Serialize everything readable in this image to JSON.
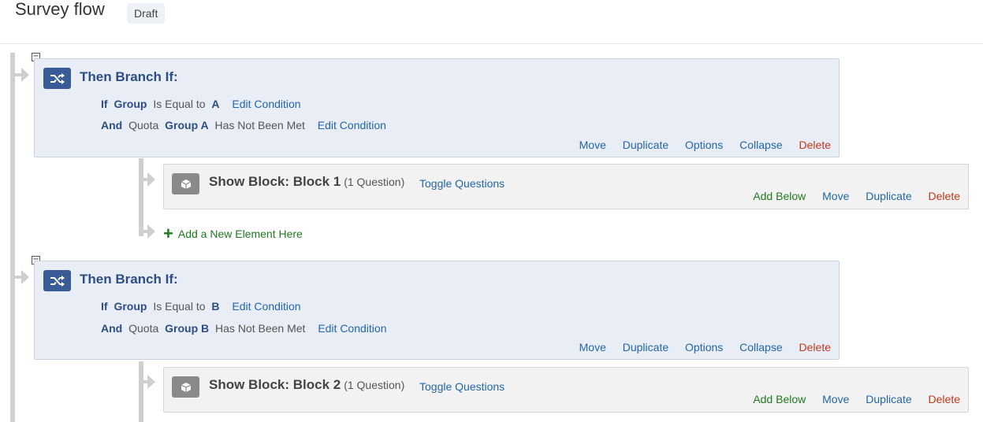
{
  "header": {
    "title": "Survey flow",
    "status": "Draft"
  },
  "branches": [
    {
      "title": "Then Branch If:",
      "conditions": [
        {
          "conj": "If",
          "part1": "Group",
          "part2": "Is Equal to",
          "part3": "A",
          "link": "Edit Condition"
        },
        {
          "conj": "And",
          "part1": "Quota",
          "part2": "Group A",
          "part3": "Has Not Been Met",
          "link": "Edit Condition"
        }
      ],
      "actions": {
        "move": "Move",
        "duplicate": "Duplicate",
        "options": "Options",
        "collapse": "Collapse",
        "delete": "Delete"
      }
    },
    {
      "title": "Then Branch If:",
      "conditions": [
        {
          "conj": "If",
          "part1": "Group",
          "part2": "Is Equal to",
          "part3": "B",
          "link": "Edit Condition"
        },
        {
          "conj": "And",
          "part1": "Quota",
          "part2": "Group B",
          "part3": "Has Not Been Met",
          "link": "Edit Condition"
        }
      ],
      "actions": {
        "move": "Move",
        "duplicate": "Duplicate",
        "options": "Options",
        "collapse": "Collapse",
        "delete": "Delete"
      }
    }
  ],
  "blocks": [
    {
      "title": "Show Block: Block 1",
      "count": "(1 Question)",
      "toggle": "Toggle Questions",
      "actions": {
        "add_below": "Add Below",
        "move": "Move",
        "duplicate": "Duplicate",
        "delete": "Delete"
      }
    },
    {
      "title": "Show Block: Block 2",
      "count": "(1 Question)",
      "toggle": "Toggle Questions",
      "actions": {
        "add_below": "Add Below",
        "move": "Move",
        "duplicate": "Duplicate",
        "delete": "Delete"
      }
    }
  ],
  "add_element": {
    "label": "Add a New Element Here"
  },
  "collapse_toggle": {
    "symbol": "−"
  },
  "colors": {
    "branch_accent": "#3a5c96",
    "delete_red": "#c0391b",
    "add_green": "#1f7a1f",
    "link_blue": "#2466a8"
  },
  "icons": {
    "branch": "branch-icon",
    "block": "cube-icon",
    "add": "plus-icon",
    "collapse": "collapse-icon"
  }
}
